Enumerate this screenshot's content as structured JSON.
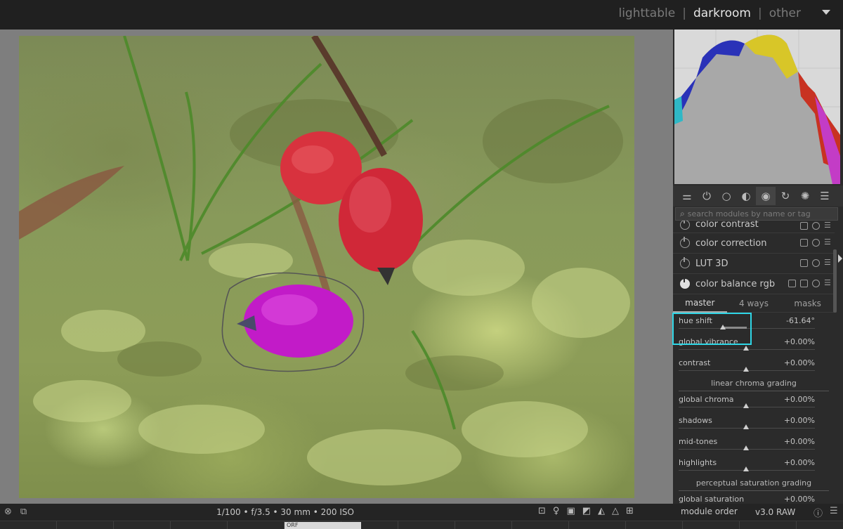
{
  "views": {
    "lighttable": "lighttable",
    "darkroom": "darkroom",
    "other": "other",
    "sep": "|"
  },
  "search": {
    "placeholder": "search modules by name or tag"
  },
  "modules": [
    {
      "name": "color contrast",
      "on": false
    },
    {
      "name": "color correction",
      "on": false
    },
    {
      "name": "LUT 3D",
      "on": false
    },
    {
      "name": "color balance rgb",
      "on": true
    }
  ],
  "tabs": [
    "master",
    "4 ways",
    "masks"
  ],
  "sliders_top": [
    {
      "label": "hue shift",
      "value": "-61.64°",
      "level": -0.17
    },
    {
      "label": "global vibrance",
      "value": "+0.00%",
      "level": 0
    },
    {
      "label": "contrast",
      "value": "+0.00%",
      "level": 0
    }
  ],
  "section_linear": "linear chroma grading",
  "sliders_linear": [
    {
      "label": "global chroma",
      "value": "+0.00%"
    },
    {
      "label": "shadows",
      "value": "+0.00%"
    },
    {
      "label": "mid-tones",
      "value": "+0.00%"
    },
    {
      "label": "highlights",
      "value": "+0.00%"
    }
  ],
  "section_perceptual": "perceptual saturation grading",
  "sliders_perceptual": [
    {
      "label": "global saturation",
      "value": "+0.00%"
    }
  ],
  "bottom": {
    "exif": "1/100 • f/3.5 • 30 mm • 200 ISO",
    "module_order": "module order",
    "version": "v3.0 RAW",
    "filmstrip_label": "ORF"
  }
}
